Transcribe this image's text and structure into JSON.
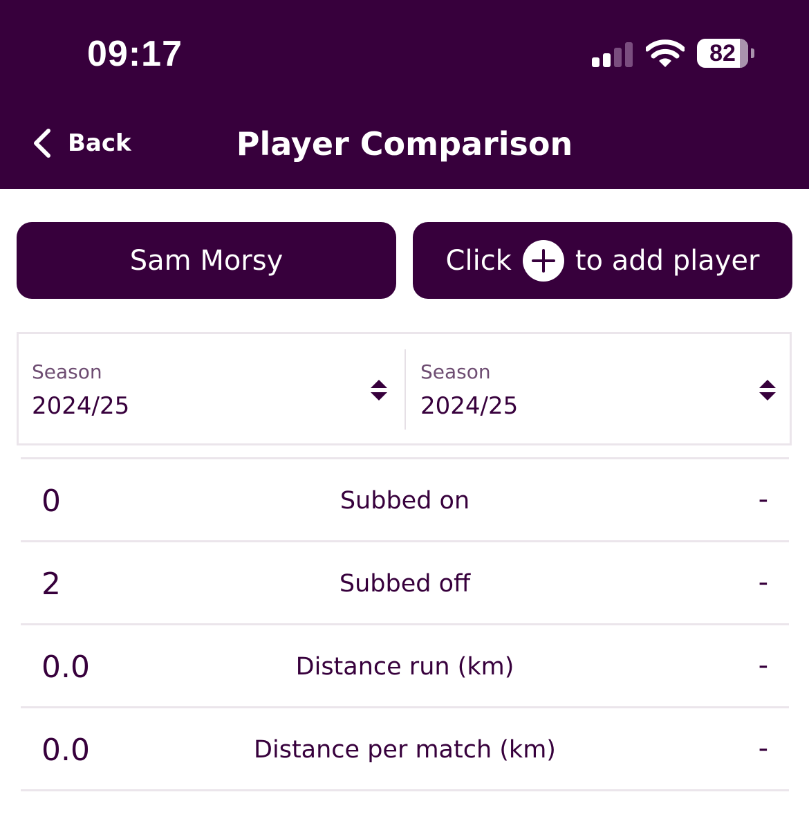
{
  "status_bar": {
    "time": "09:17",
    "battery": "82"
  },
  "nav": {
    "back_label": "Back",
    "title": "Player Comparison"
  },
  "players": {
    "left": "Sam Morsy",
    "right_prefix": "Click",
    "right_suffix": "to add player"
  },
  "seasons": [
    {
      "label": "Season",
      "value": "2024/25"
    },
    {
      "label": "Season",
      "value": "2024/25"
    }
  ],
  "stats": [
    {
      "left": "0",
      "label": "Subbed on",
      "right": "-"
    },
    {
      "left": "2",
      "label": "Subbed off",
      "right": "-"
    },
    {
      "left": "0.0",
      "label": "Distance run (km)",
      "right": "-"
    },
    {
      "left": "0.0",
      "label": "Distance per match (km)",
      "right": "-"
    }
  ],
  "colors": {
    "brand": "#37003c",
    "background": "#ffffff",
    "divider": "#ebe5eb"
  }
}
